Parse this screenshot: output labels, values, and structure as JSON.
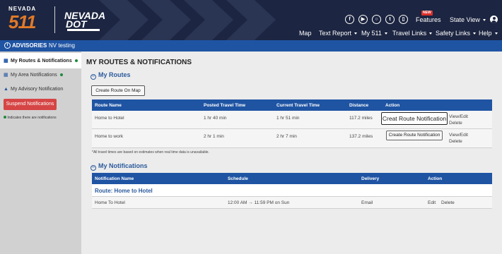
{
  "header": {
    "logo_state_text": "NEVADA",
    "logo_number": "511",
    "logo_dot_line1": "NEVADA",
    "logo_dot_line2": "DOT",
    "social_icons": [
      "facebook-icon",
      "youtube-icon",
      "instagram-icon",
      "twitter-icon",
      "mobile-app-icon"
    ],
    "features_label": "Features",
    "new_badge": "NEW",
    "state_view_label": "State View",
    "nav": [
      "Map",
      "Text Report",
      "My 511",
      "Travel Links",
      "Safety Links",
      "Help"
    ]
  },
  "advisory_bar": {
    "label": "ADVISORIES",
    "message": "NV testing"
  },
  "sidebar": {
    "items": [
      {
        "label": "My Routes & Notifications",
        "icon": "route-icon"
      },
      {
        "label": "My Area Notifications",
        "icon": "map-icon"
      },
      {
        "label": "My Advisory Notification",
        "icon": "warning-icon"
      }
    ],
    "suspend_label": "Suspend Notifications",
    "indicator_note": "Indicates there are notifications",
    "indicator_color": "#1e8a3b"
  },
  "main": {
    "title": "MY ROUTES & NOTIFICATIONS",
    "routes_heading": "My Routes",
    "create_route_label": "Create Route On Map",
    "routes_table": {
      "headers": [
        "Route Name",
        "Posted Travel Time",
        "Current Travel Time",
        "Distance",
        "Action"
      ],
      "rows": [
        {
          "name": "Home to Hotel",
          "posted": "1 hr 40 min",
          "current": "1 hr 51 min",
          "distance": "117.2 miles",
          "button": "Creat Route Notification",
          "view_edit": "View/Edit",
          "delete": "Delete"
        },
        {
          "name": "Home to work",
          "posted": "2 hr 1 min",
          "current": "2 hr 7 min",
          "distance": "137.2 miles",
          "button": "Create Route Notification",
          "view_edit": "View/Edit",
          "delete": "Delete"
        }
      ]
    },
    "footnote": "*All travel times are based on estimates when real time data is unavailable.",
    "notifications_heading": "My Notifications",
    "notifications_table": {
      "headers": [
        "Notification Name",
        "Schedule",
        "Delivery",
        "Action"
      ],
      "group_label": "Route: Home to Hotel",
      "rows": [
        {
          "name": "Home To Hotel",
          "schedule": "12:00 AM → 11:59 PM on Sun",
          "delivery": "Email",
          "edit": "Edit",
          "delete": "Delete"
        }
      ]
    }
  },
  "colors": {
    "header_bg": "#1c2541",
    "advisory_bg": "#1f54a3",
    "table_header_bg": "#1f54a3",
    "logo_orange": "#e07a28",
    "suspend_red": "#d64545",
    "heading_blue": "#2b5a9c"
  }
}
